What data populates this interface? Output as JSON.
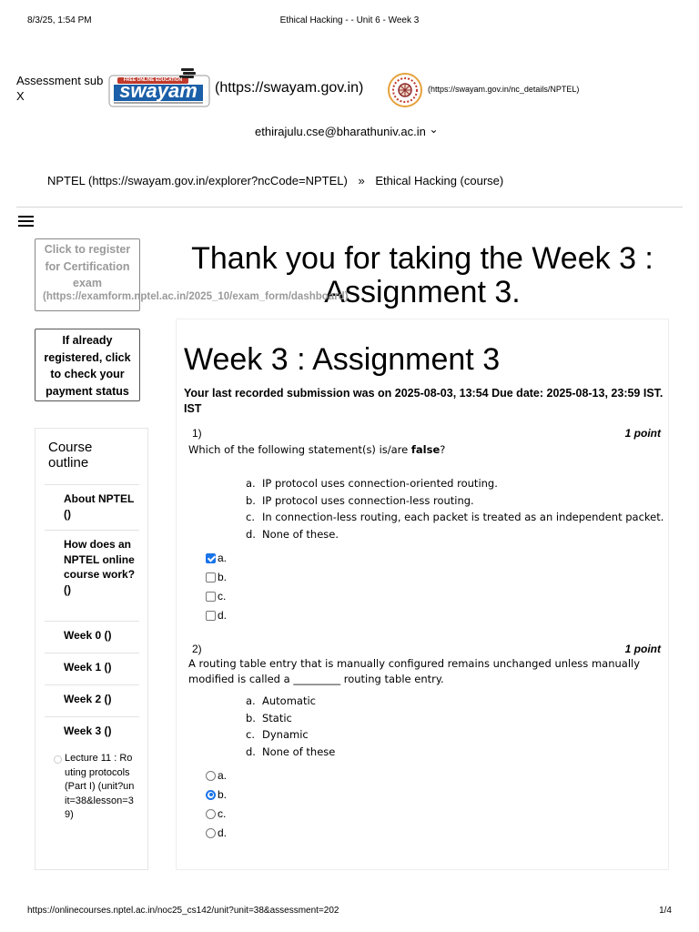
{
  "print_header": {
    "datetime": "8/3/25, 1:54 PM",
    "doc_title": "Ethical Hacking - - Unit 6 - Week 3"
  },
  "header": {
    "assessment_sub": "Assessment sub",
    "close_x": "X",
    "swayam_logo_text": "swayam",
    "swayam_logo_tag": "FREE ONLINE EDUCATION",
    "swayam_link": "(https://swayam.gov.in)",
    "nptel_link": "(https://swayam.gov.in/nc_details/NPTEL)",
    "user_email": "ethirajulu.cse@bharathuniv.ac.in",
    "user_caret": "⌄"
  },
  "breadcrumb": {
    "root": "NPTEL (https://swayam.gov.in/explorer?ncCode=NPTEL)",
    "sep": "»",
    "current": "Ethical Hacking (course)"
  },
  "sidebar": {
    "register_lines": [
      "Click to register",
      "for Certification",
      "exam"
    ],
    "register_url": "(https://examform.nptel.ac.in/2025_10/exam_form/dashboard)",
    "payment_lines": [
      "If already",
      "registered, click",
      "to check your",
      "payment status"
    ],
    "outline_title": "Course outline",
    "items": [
      {
        "label": "About NPTEL ()"
      },
      {
        "label": "How does an NPTEL online course work? ()"
      },
      {
        "label": "Week 0 ()"
      },
      {
        "label": "Week 1 ()"
      },
      {
        "label": "Week 2 ()"
      },
      {
        "label": "Week 3 ()"
      }
    ],
    "lecture": "Lecture 11 : Routing protocols (Part I) (unit?unit=38&lesson=39)"
  },
  "main": {
    "thanks": "Thank you for taking the Week 3 : Assignment 3.",
    "title": "Week 3 : Assignment 3",
    "submission": "Your last recorded submission was on 2025-08-03, 13:54  Due date: 2025-08-13, 23:59 IST. IST",
    "questions": [
      {
        "num": "1)",
        "points": "1 point",
        "text_pre": "Which of the following statement(s) is/are ",
        "text_bold": "false",
        "text_post": "?",
        "options": [
          {
            "letter": "a.",
            "text": "IP protocol uses connection-oriented routing."
          },
          {
            "letter": "b.",
            "text": "IP protocol uses connection-less routing."
          },
          {
            "letter": "c.",
            "text": "In connection-less routing, each packet is treated as an independent packet."
          },
          {
            "letter": "d.",
            "text": "None of these."
          }
        ],
        "choices": [
          {
            "label": "a.",
            "checked": true
          },
          {
            "label": "b.",
            "checked": false
          },
          {
            "label": "c.",
            "checked": false
          },
          {
            "label": "d.",
            "checked": false
          }
        ]
      },
      {
        "num": "2)",
        "points": "1 point",
        "text": "A routing table entry that is manually configured remains unchanged unless manually modified is called a _________ routing table entry.",
        "options": [
          {
            "letter": "a.",
            "text": "Automatic"
          },
          {
            "letter": "b.",
            "text": "Static"
          },
          {
            "letter": "c.",
            "text": "Dynamic"
          },
          {
            "letter": "d.",
            "text": "None of these"
          }
        ],
        "choices": [
          {
            "label": "a.",
            "checked": false
          },
          {
            "label": "b.",
            "checked": true
          },
          {
            "label": "c.",
            "checked": false
          },
          {
            "label": "d.",
            "checked": false
          }
        ]
      }
    ]
  },
  "print_footer": {
    "url": "https://onlinecourses.nptel.ac.in/noc25_cs142/unit?unit=38&assessment=202",
    "page": "1/4"
  },
  "colors": {
    "accent": "#1a73e8",
    "swayam_blue": "#1a5fa8",
    "muted_text": "#9a9a9a"
  }
}
